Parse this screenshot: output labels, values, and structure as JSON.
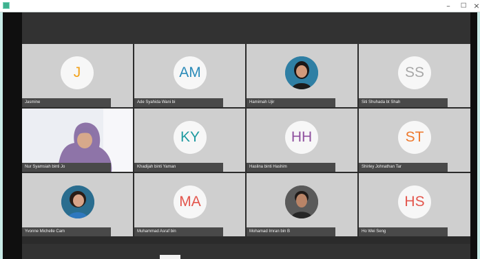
{
  "window": {
    "minimize_glyph": "–",
    "maximize_glyph": "□",
    "close_glyph": "×"
  },
  "participants": [
    {
      "name": "Jasmine",
      "initials": "J",
      "color": "#f2a21c",
      "kind": "initials"
    },
    {
      "name": "Ade Syahida Wani bi",
      "initials": "AM",
      "color": "#2a8ab8",
      "kind": "initials"
    },
    {
      "name": "Hamimah Ujir",
      "initials": "",
      "color": "#2f7fa4",
      "kind": "photo-round"
    },
    {
      "name": "Siti Shuhada bt Shah",
      "initials": "SS",
      "color": "#a8a8a8",
      "kind": "initials"
    },
    {
      "name": "Nur Syamsiah binti Jo",
      "initials": "",
      "color": "#8e74a8",
      "kind": "video"
    },
    {
      "name": "Khadijah binti Yaman",
      "initials": "KY",
      "color": "#1e9aa0",
      "kind": "initials"
    },
    {
      "name": "Haslina binti Hashim",
      "initials": "HH",
      "color": "#8e4f9e",
      "kind": "initials"
    },
    {
      "name": "Shirley Johnathan Tar",
      "initials": "ST",
      "color": "#ee7a2f",
      "kind": "initials"
    },
    {
      "name": "Yvonne Michelle Cam",
      "initials": "",
      "color": "#2a6d8f",
      "kind": "photo-round"
    },
    {
      "name": "Muhammad Asraf bin",
      "initials": "MA",
      "color": "#e3554c",
      "kind": "initials"
    },
    {
      "name": "Mohamad Imran bin B",
      "initials": "",
      "color": "#3a3a3a",
      "kind": "photo-round"
    },
    {
      "name": "Ho Wei Seng",
      "initials": "HS",
      "color": "#e3554c",
      "kind": "initials"
    }
  ]
}
